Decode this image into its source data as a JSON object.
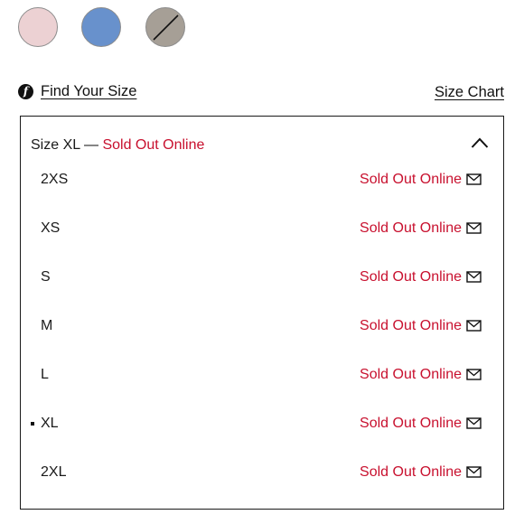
{
  "swatches": [
    {
      "name": "pink",
      "color": "#ecd1d3",
      "available": true
    },
    {
      "name": "blue",
      "color": "#6891cc",
      "available": true
    },
    {
      "name": "taupe",
      "color": "#a69f96",
      "available": false
    }
  ],
  "links": {
    "find_your_size": "Find Your Size",
    "size_chart": "Size Chart"
  },
  "dropdown": {
    "header_prefix": "Size XL —",
    "header_status": "Sold Out Online",
    "expanded": true
  },
  "sizes": [
    {
      "label": "2XS",
      "status": "Sold Out Online",
      "selected": false
    },
    {
      "label": "XS",
      "status": "Sold Out Online",
      "selected": false
    },
    {
      "label": "S",
      "status": "Sold Out Online",
      "selected": false
    },
    {
      "label": "M",
      "status": "Sold Out Online",
      "selected": false
    },
    {
      "label": "L",
      "status": "Sold Out Online",
      "selected": false
    },
    {
      "label": "XL",
      "status": "Sold Out Online",
      "selected": true
    },
    {
      "label": "2XL",
      "status": "Sold Out Online",
      "selected": false
    }
  ],
  "colors": {
    "sold_out": "#c8102e",
    "text": "#1a1a1a",
    "border": "#1a1a1a"
  },
  "icons": {
    "fit": "fit-predictor-icon",
    "chevron": "chevron-up-icon",
    "mail": "envelope-icon"
  }
}
